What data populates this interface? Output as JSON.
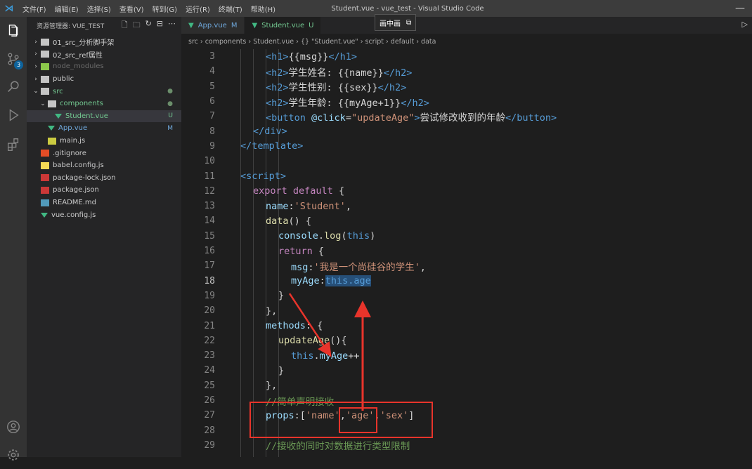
{
  "window": {
    "menu": [
      "文件(F)",
      "编辑(E)",
      "选择(S)",
      "查看(V)",
      "转到(G)",
      "运行(R)",
      "终端(T)",
      "帮助(H)"
    ],
    "title": "Student.vue - vue_test - Visual Studio Code",
    "minimize": "—"
  },
  "activity": {
    "scm_badge": "3"
  },
  "explorer": {
    "header": "资源管理器: VUE_TEST",
    "items": [
      {
        "label": "01_src_分析脚手架",
        "arrow": "›",
        "kind": "folder",
        "status": "",
        "indent": 0
      },
      {
        "label": "02_src_ref属性",
        "arrow": "›",
        "kind": "folder",
        "status": "",
        "indent": 0
      },
      {
        "label": "node_modules",
        "arrow": "›",
        "kind": "node",
        "status": "",
        "indent": 0
      },
      {
        "label": "public",
        "arrow": "›",
        "kind": "folder",
        "status": "",
        "indent": 0
      },
      {
        "label": "src",
        "arrow": "⌄",
        "kind": "folder",
        "status": "●",
        "indent": 0
      },
      {
        "label": "components",
        "arrow": "⌄",
        "kind": "folder",
        "status": "●",
        "indent": 1
      },
      {
        "label": "Student.vue",
        "arrow": "",
        "kind": "vue",
        "status": "U",
        "indent": 2
      },
      {
        "label": "App.vue",
        "arrow": "",
        "kind": "vue",
        "status": "M",
        "indent": 1
      },
      {
        "label": "main.js",
        "arrow": "",
        "kind": "js",
        "status": "",
        "indent": 1
      },
      {
        "label": ".gitignore",
        "arrow": "",
        "kind": "git",
        "status": "",
        "indent": 0
      },
      {
        "label": "babel.config.js",
        "arrow": "",
        "kind": "babel",
        "status": "",
        "indent": 0
      },
      {
        "label": "package-lock.json",
        "arrow": "",
        "kind": "npm",
        "status": "",
        "indent": 0
      },
      {
        "label": "package.json",
        "arrow": "",
        "kind": "npm",
        "status": "",
        "indent": 0
      },
      {
        "label": "README.md",
        "arrow": "",
        "kind": "md",
        "status": "",
        "indent": 0
      },
      {
        "label": "vue.config.js",
        "arrow": "",
        "kind": "vue",
        "status": "",
        "indent": 0
      }
    ]
  },
  "tabs": [
    {
      "label": "App.vue",
      "status": "M",
      "active": false
    },
    {
      "label": "Student.vue",
      "status": "U",
      "active": true
    }
  ],
  "pip": {
    "label": "画中画"
  },
  "breadcrumb": [
    "src",
    "components",
    "Student.vue",
    "{} \"Student.vue\"",
    "script",
    "default",
    "data"
  ],
  "editor": {
    "current_line": 18,
    "lines": [
      {
        "n": 3,
        "indent": 2,
        "tokens": [
          [
            "<h1>",
            "#569cd6"
          ],
          [
            "{{msg}}",
            "#d4d4d4"
          ],
          [
            "</h1>",
            "#569cd6"
          ]
        ]
      },
      {
        "n": 4,
        "indent": 2,
        "tokens": [
          [
            "<h2>",
            "#569cd6"
          ],
          [
            "学生姓名: {{name}}",
            "#d4d4d4"
          ],
          [
            "</h2>",
            "#569cd6"
          ]
        ]
      },
      {
        "n": 5,
        "indent": 2,
        "tokens": [
          [
            "<h2>",
            "#569cd6"
          ],
          [
            "学生性别: {{sex}}",
            "#d4d4d4"
          ],
          [
            "</h2>",
            "#569cd6"
          ]
        ]
      },
      {
        "n": 6,
        "indent": 2,
        "tokens": [
          [
            "<h2>",
            "#569cd6"
          ],
          [
            "学生年龄: {{myAge+1}}",
            "#d4d4d4"
          ],
          [
            "</h2>",
            "#569cd6"
          ]
        ]
      },
      {
        "n": 7,
        "indent": 2,
        "tokens": [
          [
            "<button ",
            "#569cd6"
          ],
          [
            "@click",
            "#9cdcfe"
          ],
          [
            "=",
            "#d4d4d4"
          ],
          [
            "\"updateAge\"",
            "#ce9178"
          ],
          [
            ">",
            "#569cd6"
          ],
          [
            "尝试修改收到的年龄",
            "#d4d4d4"
          ],
          [
            "</button>",
            "#569cd6"
          ]
        ]
      },
      {
        "n": 8,
        "indent": 1,
        "tokens": [
          [
            "</div>",
            "#569cd6"
          ]
        ]
      },
      {
        "n": 9,
        "indent": 0,
        "tokens": [
          [
            "</template>",
            "#569cd6"
          ]
        ]
      },
      {
        "n": 10,
        "indent": 0,
        "tokens": []
      },
      {
        "n": 11,
        "indent": 0,
        "tokens": [
          [
            "<script>",
            "#569cd6"
          ]
        ]
      },
      {
        "n": 12,
        "indent": 1,
        "tokens": [
          [
            "export ",
            "#c586c0"
          ],
          [
            "default ",
            "#c586c0"
          ],
          [
            "{",
            "#d4d4d4"
          ]
        ]
      },
      {
        "n": 13,
        "indent": 2,
        "tokens": [
          [
            "name",
            "#9cdcfe"
          ],
          [
            ":",
            "#d4d4d4"
          ],
          [
            "'Student'",
            "#ce9178"
          ],
          [
            ",",
            "#d4d4d4"
          ]
        ]
      },
      {
        "n": 14,
        "indent": 2,
        "tokens": [
          [
            "data",
            "#dcdcaa"
          ],
          [
            "() {",
            "#d4d4d4"
          ]
        ]
      },
      {
        "n": 15,
        "indent": 3,
        "tokens": [
          [
            "console",
            "#9cdcfe"
          ],
          [
            ".",
            "#d4d4d4"
          ],
          [
            "log",
            "#dcdcaa"
          ],
          [
            "(",
            "#d4d4d4"
          ],
          [
            "this",
            "#569cd6"
          ],
          [
            ")",
            "#d4d4d4"
          ]
        ]
      },
      {
        "n": 16,
        "indent": 3,
        "tokens": [
          [
            "return ",
            "#c586c0"
          ],
          [
            "{",
            "#d4d4d4"
          ]
        ]
      },
      {
        "n": 17,
        "indent": 4,
        "tokens": [
          [
            "msg",
            "#9cdcfe"
          ],
          [
            ":",
            "#d4d4d4"
          ],
          [
            "'我是一个尚硅谷的学生'",
            "#ce9178"
          ],
          [
            ",",
            "#d4d4d4"
          ]
        ]
      },
      {
        "n": 18,
        "indent": 4,
        "tokens": [
          [
            "myAge",
            "#9cdcfe"
          ],
          [
            ":",
            "#d4d4d4"
          ],
          [
            "this.age",
            "#569cd6",
            "hl"
          ]
        ]
      },
      {
        "n": 19,
        "indent": 3,
        "tokens": [
          [
            "}",
            "#d4d4d4"
          ]
        ]
      },
      {
        "n": 20,
        "indent": 2,
        "tokens": [
          [
            "},",
            "#d4d4d4"
          ]
        ]
      },
      {
        "n": 21,
        "indent": 2,
        "tokens": [
          [
            "methods",
            "#9cdcfe"
          ],
          [
            ": {",
            "#d4d4d4"
          ]
        ]
      },
      {
        "n": 22,
        "indent": 3,
        "tokens": [
          [
            "updateAge",
            "#dcdcaa"
          ],
          [
            "(){",
            "#d4d4d4"
          ]
        ]
      },
      {
        "n": 23,
        "indent": 4,
        "tokens": [
          [
            "this",
            "#569cd6"
          ],
          [
            ".",
            "#d4d4d4"
          ],
          [
            "myAge",
            "#9cdcfe"
          ],
          [
            "++",
            "#d4d4d4"
          ]
        ]
      },
      {
        "n": 24,
        "indent": 3,
        "tokens": [
          [
            "}",
            "#d4d4d4"
          ]
        ]
      },
      {
        "n": 25,
        "indent": 2,
        "tokens": [
          [
            "},",
            "#d4d4d4"
          ]
        ]
      },
      {
        "n": 26,
        "indent": 2,
        "tokens": [
          [
            "//简单声明接收",
            "#6a9955"
          ]
        ]
      },
      {
        "n": 27,
        "indent": 2,
        "tokens": [
          [
            "props",
            "#9cdcfe"
          ],
          [
            ":[",
            "#d4d4d4"
          ],
          [
            "'name'",
            "#ce9178"
          ],
          [
            ",",
            "#d4d4d4"
          ],
          [
            "'age'",
            "#ce9178"
          ],
          [
            ",",
            "#d4d4d4"
          ],
          [
            "'sex'",
            "#ce9178"
          ],
          [
            "]",
            "#d4d4d4"
          ]
        ]
      },
      {
        "n": 28,
        "indent": 0,
        "tokens": []
      },
      {
        "n": 29,
        "indent": 2,
        "tokens": [
          [
            "//接收的同时对数据进行类型限制",
            "#6a9955"
          ]
        ]
      }
    ]
  },
  "colors": {
    "annotation": "#e8342b",
    "selection": "#264f78",
    "vue_green": "#41b883"
  }
}
